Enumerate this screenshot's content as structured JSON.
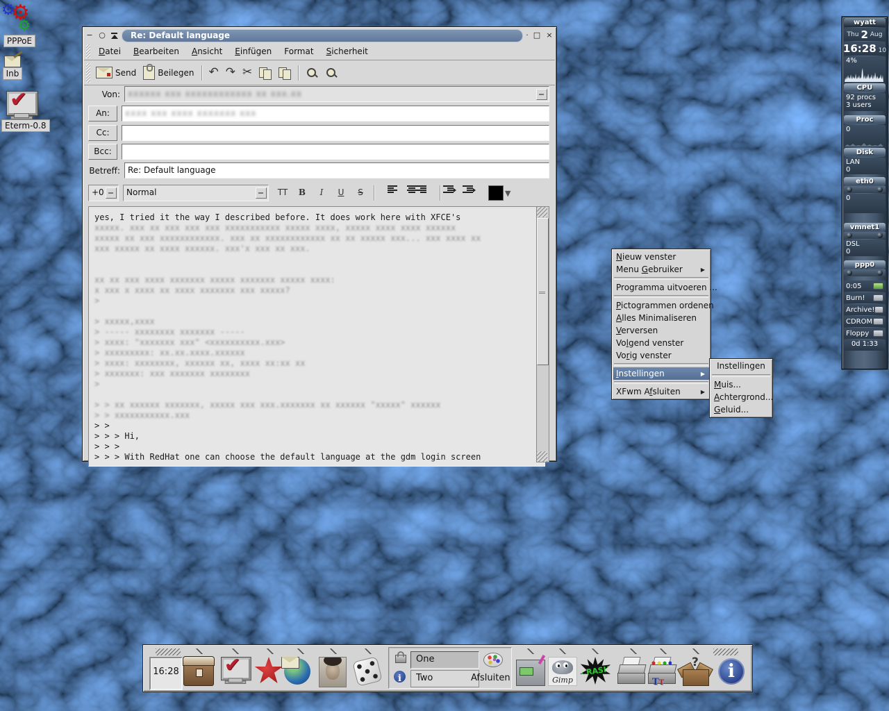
{
  "desktop": {
    "icons": [
      {
        "name": "pppoe",
        "label": "PPPoE"
      },
      {
        "name": "inbox",
        "label": "Inb"
      },
      {
        "name": "eterm",
        "label": "Eterm-0.8"
      }
    ]
  },
  "window": {
    "title": "Re: Default language",
    "menubar": [
      {
        "label": "Datei",
        "u": 0
      },
      {
        "label": "Bearbeiten",
        "u": 0
      },
      {
        "label": "Ansicht",
        "u": 0
      },
      {
        "label": "Einfügen",
        "u": 0
      },
      {
        "label": "Format",
        "u": -1
      },
      {
        "label": "Sicherheit",
        "u": 0
      }
    ],
    "toolbar": {
      "send_label": "Send",
      "attach_label": "Beilegen"
    },
    "compose": {
      "from_label": "Von:",
      "to_label": "An:",
      "cc_label": "Cc:",
      "bcc_label": "Bcc:",
      "subject_label": "Betreff:",
      "subject_value": "Re: Default language",
      "from_value_redacted": "xxxxxx xxx xxxxxxxxxxxx xx xxx.xx",
      "to_value_redacted": "xxxx xxx xxxx xxxxxxx xxx"
    },
    "format_bar": {
      "size": "+0",
      "paragraph": "Normal",
      "tt": "TT",
      "bold": "B",
      "italic": "I",
      "underline": "U",
      "strike": "S",
      "color_arrow": "▼"
    },
    "body_lines": [
      {
        "t": "yes, I tried it the way I described before. It does work here with XFCE's",
        "rx": false
      },
      {
        "t": "xxxxx. xxx xx xxx xxx xxx xxxxxxxxxxx xxxxx xxxx, xxxxx xxxx xxxx xxxxxx",
        "rx": true
      },
      {
        "t": "xxxxx xx xxx xxxxxxxxxxxx. xxx xx xxxxxxxxxxxx xx xx xxxxx xxx... xxx xxxx xx",
        "rx": true
      },
      {
        "t": "xxx xxxxx xx xxxx xxxxxx. xxx'x xxx xx xxx.",
        "rx": true
      },
      {
        "t": "",
        "rx": false
      },
      {
        "t": "",
        "rx": false
      },
      {
        "t": "xx xx xxx xxxx xxxxxxx xxxxx xxxxxxx xxxxx xxxx:",
        "rx": true
      },
      {
        "t": "x xxx x xxxx xx xxxx xxxxxxx xxx xxxxx?",
        "rx": true
      },
      {
        "t": ">",
        "rx": true
      },
      {
        "t": "",
        "rx": false
      },
      {
        "t": "> xxxxx,xxxx",
        "rx": true
      },
      {
        "t": "> ----- xxxxxxxx xxxxxxx -----",
        "rx": true
      },
      {
        "t": "> xxxx: \"xxxxxxx xxx\" <xxxxxxxxxx.xxx>",
        "rx": true
      },
      {
        "t": "> xxxxxxxxx: xx.xx.xxxx.xxxxxx",
        "rx": true
      },
      {
        "t": "> xxxx: xxxxxxxx, xxxxxx xx, xxxx xx:xx xx",
        "rx": true
      },
      {
        "t": "> xxxxxxx: xxx xxxxxxx xxxxxxxx",
        "rx": true
      },
      {
        "t": ">",
        "rx": true
      },
      {
        "t": "",
        "rx": false
      },
      {
        "t": "> > xx xxxxxx xxxxxxx, xxxxx xxx xxx.xxxxxxx xx xxxxxx \"xxxxx\" xxxxxx",
        "rx": true
      },
      {
        "t": "> > xxxxxxxxxxx.xxx",
        "rx": true
      },
      {
        "t": "> >",
        "rx": false
      },
      {
        "t": "> > > Hi,",
        "rx": false
      },
      {
        "t": "> > >",
        "rx": false
      },
      {
        "t": "> > > With RedHat one can choose the default language at the gdm login screen",
        "rx": false
      }
    ]
  },
  "context_menu": {
    "items": [
      {
        "label": "Nieuw venster",
        "u": 0
      },
      {
        "label": "Menu Gebruiker",
        "u": 5,
        "arrow": true
      },
      {
        "sep": true
      },
      {
        "label": "Programma uitvoeren ...",
        "u": -1
      },
      {
        "sep": true
      },
      {
        "label": "Pictogrammen ordenen",
        "u": 0
      },
      {
        "label": "Alles Minimaliseren",
        "u": 0
      },
      {
        "label": "Verversen",
        "u": 0
      },
      {
        "label": "Volgend venster",
        "u": 2
      },
      {
        "label": "Vorig venster",
        "u": 2
      },
      {
        "sep": true
      },
      {
        "label": "Instellingen",
        "u": 0,
        "arrow": true,
        "highlight": true
      },
      {
        "sep": true
      },
      {
        "label": "XFwm Afsluiten",
        "u": 6,
        "arrow": true
      }
    ],
    "submenu": {
      "title": "Instellingen",
      "items": [
        {
          "label": "Muis...",
          "u": 0
        },
        {
          "label": "Achtergrond...",
          "u": 0
        },
        {
          "label": "Geluid...",
          "u": 0
        }
      ]
    }
  },
  "monitor": {
    "hostname": "wyatt",
    "date_dow": "Thu",
    "date_day": "2",
    "date_month": "Aug",
    "time": "16:28",
    "time_sec": "10",
    "cpu_pct": "4%",
    "cpu_label": "CPU",
    "procs": "92 procs",
    "users": "3  users",
    "proc_label": "Proc",
    "proc_value": "0",
    "disk_label": "Disk",
    "lan_label": "LAN",
    "lan_value": "0",
    "eth0_label": "eth0",
    "eth0_value": "0",
    "vmnet_label": "vmnet1",
    "dsl_label": "DSL",
    "dsl_value": "0",
    "ppp_label": "ppp0",
    "timer": "0:05",
    "burn": "Burn!",
    "archive": "Archive!",
    "cdrom": "CDROM",
    "floppy": "Floppy",
    "uptime": "0d 1:33"
  },
  "taskbar": {
    "clock": "16:28",
    "desk_one": "One",
    "desk_two": "Two",
    "quit_label": "Afsluiten",
    "gimp_text": "Gimp",
    "crash_text": "CRASH",
    "box_question": "?",
    "info_glyph": "i"
  }
}
